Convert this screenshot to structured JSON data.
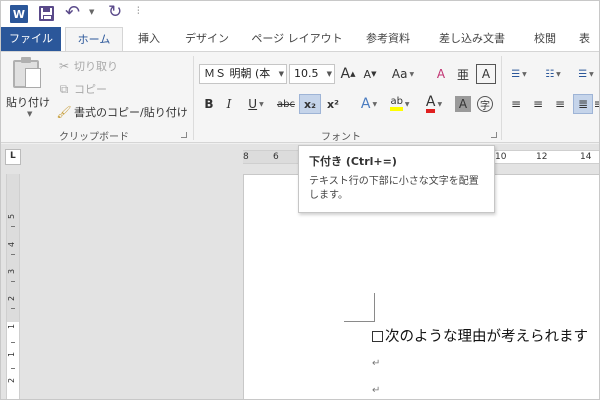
{
  "qat": {
    "app_icon_letter": "W",
    "undo_icon": "undo-icon",
    "redo_icon": "redo-icon",
    "customize_glyph": "⫶"
  },
  "tabs": {
    "file": "ファイル",
    "home": "ホーム",
    "insert": "挿入",
    "design": "デザイン",
    "layout": "ページ レイアウト",
    "references": "参考資料",
    "mailings": "差し込み文書",
    "review": "校閲",
    "view": "表"
  },
  "ribbon": {
    "clipboard": {
      "paste": "貼り付け",
      "cut": "切り取り",
      "copy": "コピー",
      "format_painter": "書式のコピー/貼り付け",
      "group_label": "クリップボード"
    },
    "font": {
      "font_name": "ＭＳ 明朝 (本",
      "font_size": "10.5",
      "grow": "A",
      "shrink": "A",
      "change_case": "Aa",
      "clear_format": "A",
      "char_border": "A",
      "bold": "B",
      "italic": "I",
      "underline": "U",
      "strikethrough": "abc",
      "subscript": "x₂",
      "superscript": "x²",
      "text_effect": "A",
      "highlight": "ab",
      "font_color": "A",
      "char_shading": "A",
      "enclose": "字",
      "group_label": "フォント"
    }
  },
  "ruler": {
    "h_numbers": [
      "8",
      "6",
      "10",
      "12",
      "14"
    ],
    "v_numbers": [
      "5",
      "4",
      "3",
      "2",
      "1",
      "1",
      "2"
    ]
  },
  "tooltip": {
    "title": "下付き (Ctrl+=)",
    "description": "テキスト行の下部に小さな文字を配置します。"
  },
  "document": {
    "line1": "次のような理由が考えられます",
    "para_mark": "↵"
  },
  "colors": {
    "brand": "#2b579a",
    "active_button": "#c5d4ea",
    "highlight_yellow": "#ffff00",
    "font_red": "#e02020"
  }
}
